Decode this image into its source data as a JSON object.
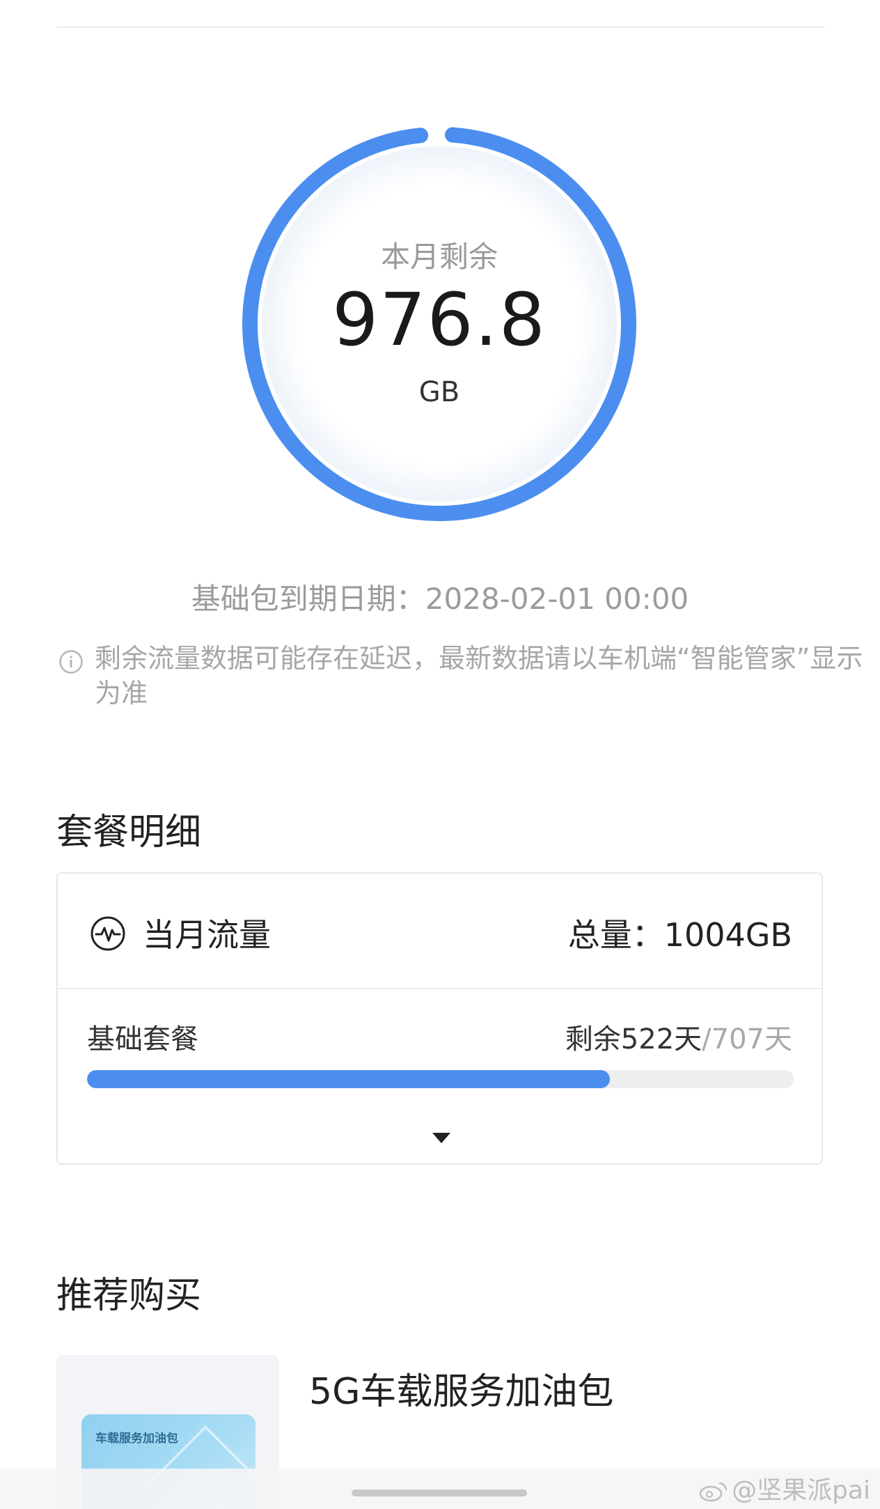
{
  "remaining": {
    "label": "本月剩余",
    "value": "976.8",
    "unit": "GB",
    "ring_fraction": 0.973,
    "ring_color": "#4b8ef0"
  },
  "expiry_text": "基础包到期日期：2028-02-01 00:00",
  "notice": {
    "icon": "info-icon",
    "text": "剩余流量数据可能存在延迟，最新数据请以车机端“智能管家”显示为准"
  },
  "plan_section": {
    "title": "套餐明细",
    "card": {
      "icon": "pulse-icon",
      "title": "当月流量",
      "total": "总量：1004GB",
      "plan_name": "基础套餐",
      "days_remaining": "剩余522天",
      "days_total": "/707天",
      "progress_fraction": 0.74,
      "expand_icon": "caret-down-icon"
    }
  },
  "recommend_section": {
    "title": "推荐购买",
    "product": {
      "name": "5G车载服务加油包",
      "thumb_label": "车载服务加油包"
    }
  },
  "watermark": "@坚果派pai"
}
